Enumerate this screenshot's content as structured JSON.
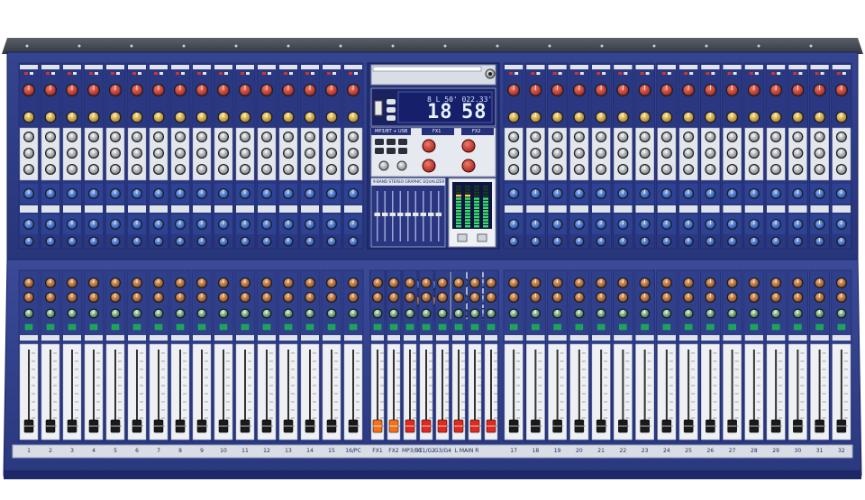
{
  "display": {
    "small_readout": "8 L 50' 022.33'",
    "track": "18",
    "time": "58"
  },
  "sections": {
    "player_label": "MP3/BT + USB",
    "fx1_label": "FX1",
    "fx2_label": "FX2",
    "eq_title": "9-BAND STEREO GRAPHIC EQUALIZER"
  },
  "channel_labels_left": [
    "1",
    "2",
    "3",
    "4",
    "5",
    "6",
    "7",
    "8",
    "9",
    "10",
    "11",
    "12",
    "13",
    "14",
    "15",
    "16/PC"
  ],
  "center_labels": [
    "FX1",
    "FX2",
    "MP3/BT",
    "G1/G2",
    "G3/G4",
    "L MAIN R"
  ],
  "channel_labels_right": [
    "17",
    "18",
    "19",
    "20",
    "21",
    "22",
    "23",
    "24",
    "25",
    "26",
    "27",
    "28",
    "29",
    "30",
    "31",
    "32"
  ],
  "colors": {
    "chassis": "#2f3e8c",
    "chassis_dark": "#1c2766",
    "panel": "#e9ecf1",
    "knob_red": "#c8372e",
    "knob_blue": "#3569c9",
    "fader_orange": "#f2711c",
    "fader_red": "#e02a1f",
    "fader_black": "#1a1a1a",
    "lcd": "#16206a"
  }
}
